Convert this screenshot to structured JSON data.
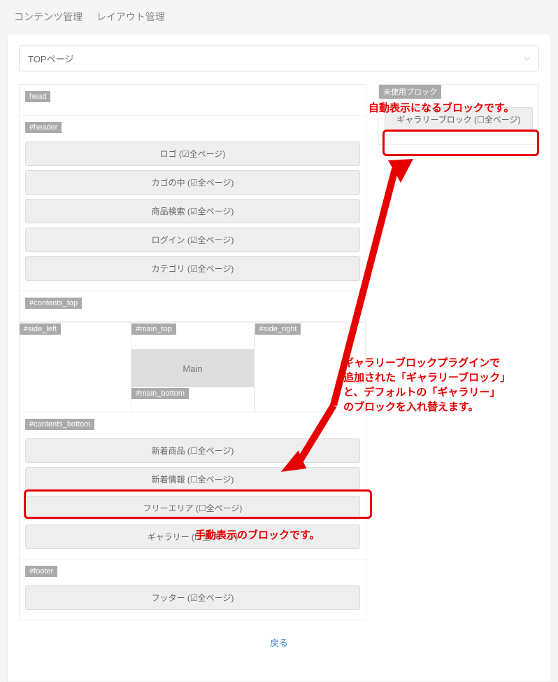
{
  "nav": {
    "content_mgmt": "コンテンツ管理",
    "layout_mgmt": "レイアウト管理"
  },
  "page_select": {
    "value": "TOPページ"
  },
  "layout": {
    "head": {
      "label": "head"
    },
    "header": {
      "label": "#header",
      "blocks": [
        {
          "text": "ロゴ (☑全ページ)"
        },
        {
          "text": "カゴの中 (☑全ページ)"
        },
        {
          "text": "商品検索 (☑全ページ)"
        },
        {
          "text": "ログイン (☑全ページ)"
        },
        {
          "text": "カテゴリ (☑全ページ)"
        }
      ]
    },
    "contents_top": {
      "label": "#contents_top"
    },
    "side_left": {
      "label": "#side_left"
    },
    "main_top": {
      "label": "#main_top"
    },
    "main": {
      "label": "Main"
    },
    "main_bottom": {
      "label": "#main_bottom"
    },
    "side_right": {
      "label": "#side_right"
    },
    "contents_bottom": {
      "label": "#contents_bottom",
      "blocks": [
        {
          "text": "新着商品 (☐全ページ)"
        },
        {
          "text": "新着情報 (☐全ページ)"
        },
        {
          "text": "フリーエリア (☐全ページ)"
        },
        {
          "text": "ギャラリー (☐全ページ)"
        }
      ]
    },
    "footer": {
      "label": "#footer",
      "blocks": [
        {
          "text": "フッター (☑全ページ)"
        }
      ]
    }
  },
  "unused": {
    "label": "未使用ブロック",
    "blocks": [
      {
        "text": "ギャラリーブロック (☐全ページ)"
      }
    ]
  },
  "back_label": "戻る",
  "annotations": {
    "top": "自動表示になるブロックです。",
    "mid_l1": "ギャラリーブロックプラグインで",
    "mid_l2": "追加された「ギャラリーブロック」",
    "mid_l3": "と、デフォルトの「ギャラリー」",
    "mid_l4": "のブロックを入れ替えます。",
    "bottom": "手動表示のブロックです。"
  }
}
